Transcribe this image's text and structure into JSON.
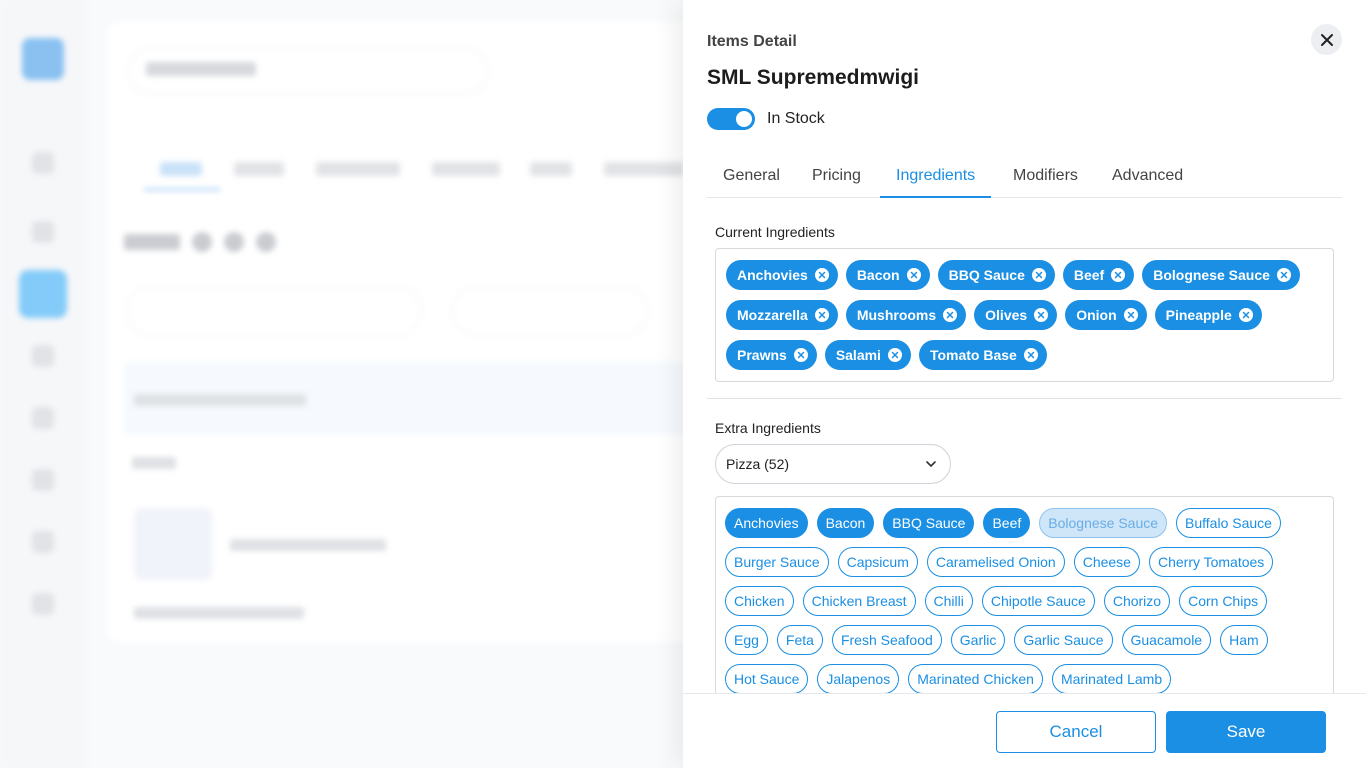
{
  "panel": {
    "kicker": "Items Detail",
    "title": "SML Supremedmwigi",
    "stock_toggle": {
      "label": "In Stock",
      "on": true
    },
    "tabs": [
      {
        "label": "General",
        "active": false
      },
      {
        "label": "Pricing",
        "active": false
      },
      {
        "label": "Ingredients",
        "active": true
      },
      {
        "label": "Modifiers",
        "active": false
      },
      {
        "label": "Advanced",
        "active": false
      }
    ],
    "current_ingredients": {
      "label": "Current Ingredients",
      "items": [
        "Anchovies",
        "Bacon",
        "BBQ Sauce",
        "Beef",
        "Bolognese Sauce",
        "Mozzarella",
        "Mushrooms",
        "Olives",
        "Onion",
        "Pineapple",
        "Prawns",
        "Salami",
        "Tomato Base"
      ]
    },
    "extra_ingredients": {
      "label": "Extra Ingredients",
      "category_select": "Pizza (52)",
      "items": [
        {
          "label": "Anchovies",
          "state": "selected"
        },
        {
          "label": "Bacon",
          "state": "selected"
        },
        {
          "label": "BBQ Sauce",
          "state": "selected"
        },
        {
          "label": "Beef",
          "state": "selected"
        },
        {
          "label": "Bolognese Sauce",
          "state": "disabled"
        },
        {
          "label": "Buffalo Sauce",
          "state": "outline"
        },
        {
          "label": "Burger Sauce",
          "state": "outline"
        },
        {
          "label": "Capsicum",
          "state": "outline"
        },
        {
          "label": "Caramelised Onion",
          "state": "outline"
        },
        {
          "label": "Cheese",
          "state": "outline"
        },
        {
          "label": "Cherry Tomatoes",
          "state": "outline"
        },
        {
          "label": "Chicken",
          "state": "outline"
        },
        {
          "label": "Chicken Breast",
          "state": "outline"
        },
        {
          "label": "Chilli",
          "state": "outline"
        },
        {
          "label": "Chipotle Sauce",
          "state": "outline"
        },
        {
          "label": "Chorizo",
          "state": "outline"
        },
        {
          "label": "Corn Chips",
          "state": "outline"
        },
        {
          "label": "Egg",
          "state": "outline"
        },
        {
          "label": "Feta",
          "state": "outline"
        },
        {
          "label": "Fresh Seafood",
          "state": "outline"
        },
        {
          "label": "Garlic",
          "state": "outline"
        },
        {
          "label": "Garlic Sauce",
          "state": "outline"
        },
        {
          "label": "Guacamole",
          "state": "outline"
        },
        {
          "label": "Ham",
          "state": "outline"
        },
        {
          "label": "Hot Sauce",
          "state": "outline"
        },
        {
          "label": "Jalapenos",
          "state": "outline"
        },
        {
          "label": "Marinated Chicken",
          "state": "outline"
        },
        {
          "label": "Marinated Lamb",
          "state": "outline"
        }
      ]
    },
    "footer": {
      "cancel_label": "Cancel",
      "save_label": "Save"
    }
  },
  "colors": {
    "accent": "#1a8fe3",
    "chip_disabled_bg": "#cfe5f8"
  }
}
